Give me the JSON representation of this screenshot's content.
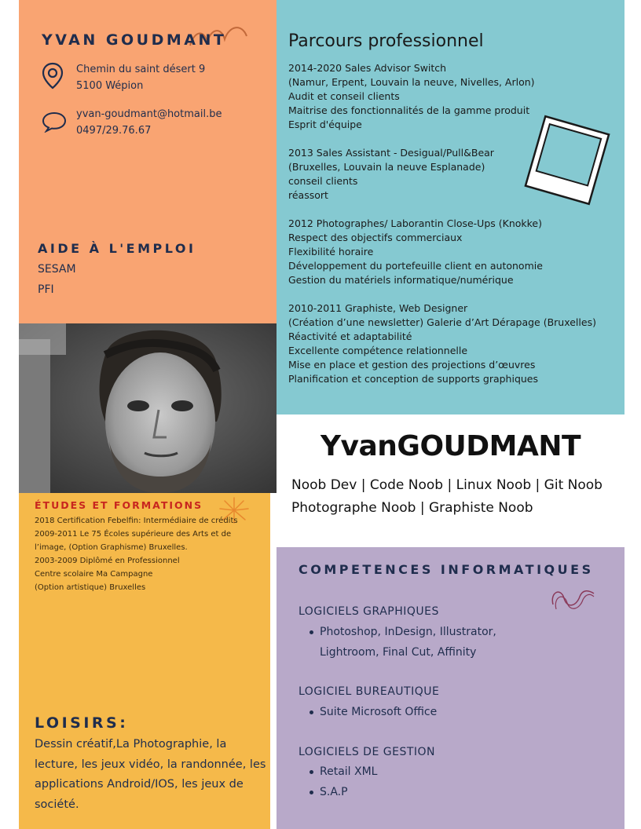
{
  "header": {
    "name": "YVAN GOUDMANT",
    "address_line1": "Chemin du saint désert 9",
    "address_line2": "5100 Wépion",
    "email": "yvan-goudmant@hotmail.be",
    "phone": "0497/29.76.67",
    "location_icon": "location-pin-icon",
    "contact_icon": "speech-bubble-icon"
  },
  "aide": {
    "title": "AIDE À L'EMPLOI",
    "items": [
      "SESAM",
      "PFI"
    ]
  },
  "parcours": {
    "title": "Parcours professionnel",
    "entries": [
      {
        "lines": [
          "2014-2020 Sales Advisor Switch",
          "(Namur, Erpent, Louvain la neuve, Nivelles, Arlon)",
          "Audit et conseil clients",
          "Maitrise des fonctionnalités de la gamme produit",
          "Esprit d'équipe"
        ]
      },
      {
        "lines": [
          "2013 Sales Assistant - Desigual/Pull&Bear",
          "(Bruxelles, Louvain la neuve Esplanade)",
          "conseil clients",
          "réassort"
        ]
      },
      {
        "lines": [
          "2012 Photographes/ Laborantin Close-Ups (Knokke)",
          "Respect des objectifs commerciaux",
          "Flexibilité horaire",
          "Développement du portefeuille client en autonomie",
          "Gestion du matériels informatique/numérique"
        ]
      },
      {
        "lines": [
          "2010-2011 Graphiste, Web Designer",
          "(Création d’une newsletter) Galerie d’Art Dérapage (Bruxelles)",
          "Réactivité et adaptabilité",
          "Excellente compétence relationnelle",
          "Mise en place et gestion des projections d’œuvres",
          "Planification et conception de supports graphiques"
        ]
      }
    ]
  },
  "profile": {
    "big_name": "YvanGOUDMANT",
    "tagline": "Noob Dev | Code Noob | Linux Noob | Git Noob Photographe Noob | Graphiste Noob"
  },
  "etudes": {
    "title": "ÉTUDES ET FORMATIONS",
    "lines": [
      "2018 Certification Febelfin: Intermédiaire de crédits",
      "2009-2011 Le 75 Écoles supérieure des Arts et de",
      "l’image, (Option Graphisme) Bruxelles.",
      "2003-2009 Diplômé en Professionnel",
      "Centre scolaire Ma Campagne",
      "(Option artistique) Bruxelles"
    ]
  },
  "loisirs": {
    "title": "LOISIRS:",
    "text": "Dessin créatif,La Photographie, la lecture, les jeux vidéo, la randonnée, les applications Android/IOS, les jeux de société."
  },
  "competences": {
    "title": "COMPETENCES INFORMATIQUES",
    "groups": [
      {
        "label": "LOGICIELS GRAPHIQUES",
        "items": [
          "Photoshop, InDesign, Illustrator, Lightroom, Final Cut, Affinity"
        ]
      },
      {
        "label": "LOGICIEL BUREAUTIQUE",
        "items": [
          "Suite Microsoft Office"
        ]
      },
      {
        "label": "LOGICIELS DE GESTION",
        "items": [
          "Retail XML",
          "S.A.P"
        ]
      }
    ]
  },
  "colors": {
    "orange": "#f9a472",
    "teal": "#85c9d1",
    "yellow": "#f5b94a",
    "purple": "#b8a9c9",
    "navy": "#1f2d4d",
    "red": "#c8261f"
  }
}
